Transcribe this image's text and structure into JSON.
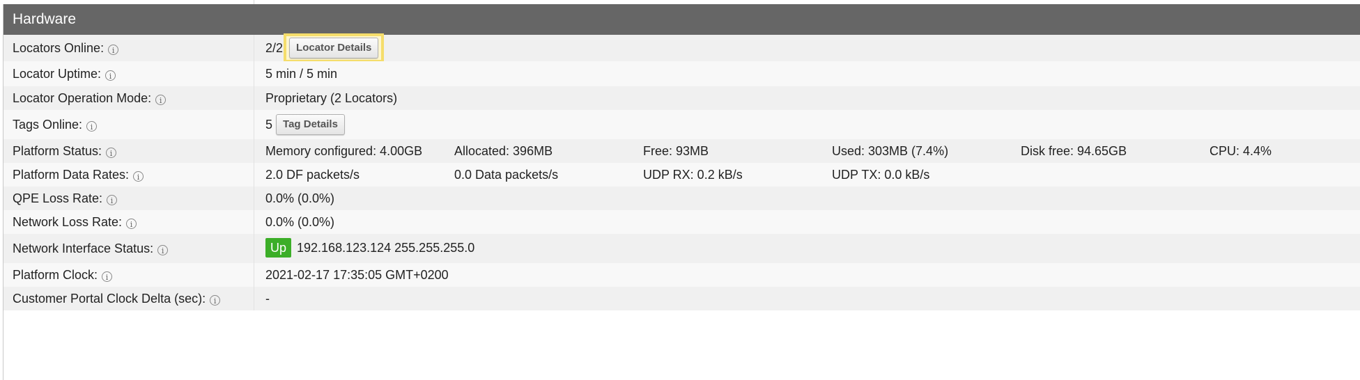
{
  "section_title": "Hardware",
  "rows": [
    {
      "label": "Locators Online:",
      "value_prefix": "2/2",
      "button": "Locator Details"
    },
    {
      "label": "Locator Uptime:",
      "value": "5 min / 5 min"
    },
    {
      "label": "Locator Operation Mode:",
      "value": "Proprietary (2 Locators)"
    },
    {
      "label": "Tags Online:",
      "value_prefix": "5",
      "button": "Tag Details"
    },
    {
      "label": "Platform Status:",
      "cols": [
        "Memory configured: 4.00GB",
        "Allocated: 396MB",
        "Free: 93MB",
        "Used: 303MB (7.4%)",
        "Disk free: 94.65GB",
        "CPU: 4.4%"
      ]
    },
    {
      "label": "Platform Data Rates:",
      "cols": [
        "2.0 DF packets/s",
        "0.0 Data packets/s",
        "UDP RX: 0.2 kB/s",
        "UDP TX: 0.0 kB/s"
      ]
    },
    {
      "label": "QPE Loss Rate:",
      "value": "0.0% (0.0%)"
    },
    {
      "label": "Network Loss Rate:",
      "value": "0.0% (0.0%)"
    },
    {
      "label": "Network Interface Status:",
      "badge": "Up",
      "value": "192.168.123.124 255.255.255.0"
    },
    {
      "label": "Platform Clock:",
      "value": "2021-02-17 17:35:05 GMT+0200"
    },
    {
      "label": "Customer Portal Clock Delta (sec):",
      "value": "-"
    }
  ],
  "info_glyph": "i",
  "colors": {
    "header_bg": "#666666",
    "badge_up": "#3cae28",
    "highlight": "#f5dd6b"
  }
}
